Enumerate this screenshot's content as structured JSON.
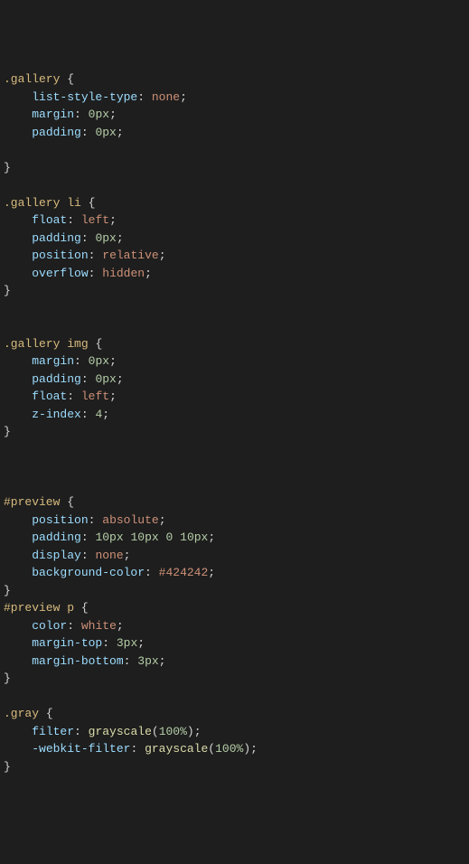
{
  "css_rules": [
    {
      "selector": ".gallery",
      "declarations": [
        {
          "property": "list-style-type",
          "value": "none"
        },
        {
          "property": "margin",
          "value": "0px"
        },
        {
          "property": "padding",
          "value": "0px"
        }
      ],
      "close_on_blank": true,
      "blank_after": 1
    },
    {
      "selector": ".gallery li",
      "declarations": [
        {
          "property": "float",
          "value": "left"
        },
        {
          "property": "padding",
          "value": "0px"
        },
        {
          "property": "position",
          "value": "relative"
        },
        {
          "property": "overflow",
          "value": "hidden"
        }
      ],
      "blank_after": 2
    },
    {
      "selector": ".gallery img",
      "declarations": [
        {
          "property": "margin",
          "value": "0px"
        },
        {
          "property": "padding",
          "value": "0px"
        },
        {
          "property": "float",
          "value": "left"
        },
        {
          "property": "z-index",
          "value": "4"
        }
      ],
      "blank_after": 3
    },
    {
      "selector": "#preview",
      "declarations": [
        {
          "property": "position",
          "value": "absolute"
        },
        {
          "property": "padding",
          "value": "10px 10px 0 10px"
        },
        {
          "property": "display",
          "value": "none"
        },
        {
          "property": "background-color",
          "value": "#424242"
        }
      ],
      "blank_after": 0
    },
    {
      "selector": "#preview p",
      "declarations": [
        {
          "property": "color",
          "value": "white"
        },
        {
          "property": "margin-top",
          "value": "3px"
        },
        {
          "property": "margin-bottom",
          "value": "3px"
        }
      ],
      "blank_after": 1
    },
    {
      "selector": ".gray",
      "declarations": [
        {
          "property": "filter",
          "value": "grayscale(100%)",
          "is_function": true
        },
        {
          "property": "-webkit-filter",
          "value": "grayscale(100%)",
          "is_function": true
        }
      ],
      "blank_after": 0
    }
  ]
}
